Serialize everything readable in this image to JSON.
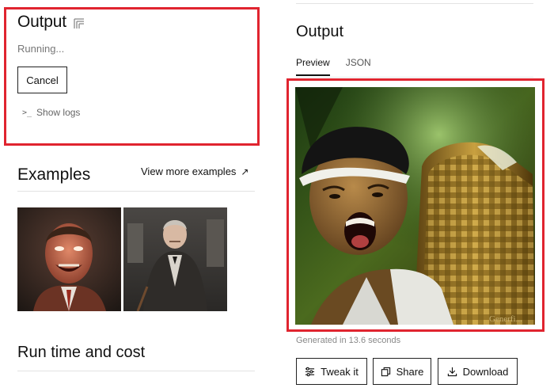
{
  "left_output": {
    "title": "Output",
    "status": "Running...",
    "cancel_label": "Cancel",
    "show_logs_label": "Show logs"
  },
  "examples": {
    "title": "Examples",
    "view_more_label": "View more examples",
    "thumbnails": [
      {
        "name": "example-thumbnail-1"
      },
      {
        "name": "example-thumbnail-2"
      }
    ]
  },
  "runtime": {
    "title": "Run time and cost"
  },
  "right_output": {
    "title": "Output",
    "tabs": [
      {
        "label": "Preview",
        "active": true
      },
      {
        "label": "JSON",
        "active": false
      }
    ],
    "image_watermark": "Generfi...",
    "generated_text": "Generated in 13.6 seconds",
    "actions": {
      "tweak_label": "Tweak it",
      "share_label": "Share",
      "download_label": "Download"
    }
  },
  "colors": {
    "highlight": "#e0242f",
    "text_primary": "#111111",
    "text_muted": "#777777"
  },
  "icons": [
    "sliders-icon",
    "terminal-icon",
    "arrow-up-right-icon",
    "sliders-icon",
    "copy-icon",
    "download-icon"
  ]
}
